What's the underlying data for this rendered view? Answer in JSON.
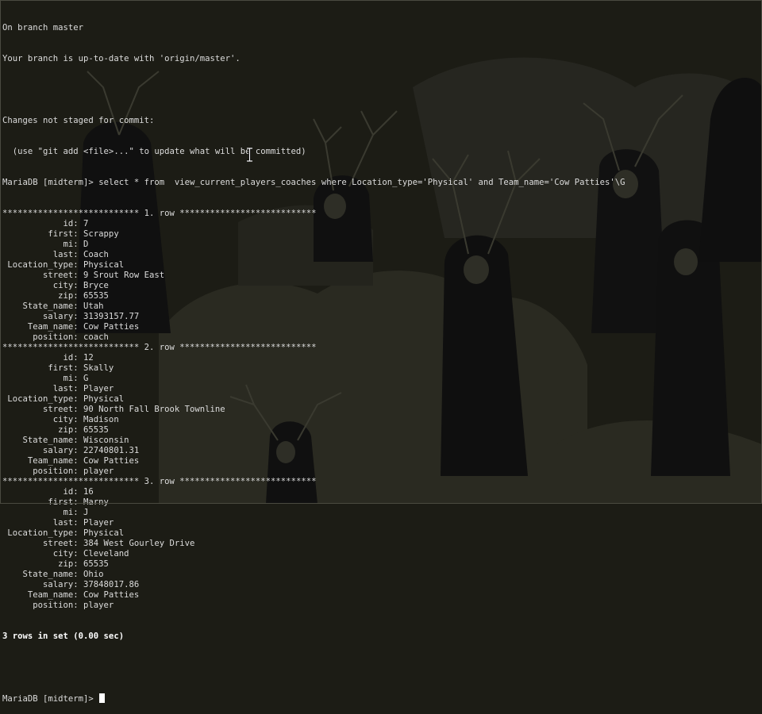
{
  "git": {
    "line1": "On branch master",
    "line2": "Your branch is up-to-date with 'origin/master'.",
    "line3": "Changes not staged for commit:",
    "line4": "  (use \"git add <file>...\" to update what will be committed)"
  },
  "query": {
    "prompt": "MariaDB [midterm]> ",
    "text": "select * from  view_current_players_coaches where Location_type='Physical' and Team_name='Cow Patties'\\G"
  },
  "row_sep": {
    "stars_left": "***************************",
    "stars_right": "***************************"
  },
  "rows": [
    {
      "header": " 1. row ",
      "fields": [
        {
          "key": "id",
          "value": "7"
        },
        {
          "key": "first",
          "value": "Scrappy"
        },
        {
          "key": "mi",
          "value": "D"
        },
        {
          "key": "last",
          "value": "Coach"
        },
        {
          "key": "Location_type",
          "value": "Physical"
        },
        {
          "key": "street",
          "value": "9 Srout Row East"
        },
        {
          "key": "city",
          "value": "Bryce"
        },
        {
          "key": "zip",
          "value": "65535"
        },
        {
          "key": "State_name",
          "value": "Utah"
        },
        {
          "key": "salary",
          "value": "31393157.77"
        },
        {
          "key": "Team_name",
          "value": "Cow Patties"
        },
        {
          "key": "position",
          "value": "coach"
        }
      ]
    },
    {
      "header": " 2. row ",
      "fields": [
        {
          "key": "id",
          "value": "12"
        },
        {
          "key": "first",
          "value": "Skally"
        },
        {
          "key": "mi",
          "value": "G"
        },
        {
          "key": "last",
          "value": "Player"
        },
        {
          "key": "Location_type",
          "value": "Physical"
        },
        {
          "key": "street",
          "value": "90 North Fall Brook Townline"
        },
        {
          "key": "city",
          "value": "Madison"
        },
        {
          "key": "zip",
          "value": "65535"
        },
        {
          "key": "State_name",
          "value": "Wisconsin"
        },
        {
          "key": "salary",
          "value": "22740801.31"
        },
        {
          "key": "Team_name",
          "value": "Cow Patties"
        },
        {
          "key": "position",
          "value": "player"
        }
      ]
    },
    {
      "header": " 3. row ",
      "fields": [
        {
          "key": "id",
          "value": "16"
        },
        {
          "key": "first",
          "value": "Marny"
        },
        {
          "key": "mi",
          "value": "J"
        },
        {
          "key": "last",
          "value": "Player"
        },
        {
          "key": "Location_type",
          "value": "Physical"
        },
        {
          "key": "street",
          "value": "384 West Gourley Drive"
        },
        {
          "key": "city",
          "value": "Cleveland"
        },
        {
          "key": "zip",
          "value": "65535"
        },
        {
          "key": "State_name",
          "value": "Ohio"
        },
        {
          "key": "salary",
          "value": "37848017.86"
        },
        {
          "key": "Team_name",
          "value": "Cow Patties"
        },
        {
          "key": "position",
          "value": "player"
        }
      ]
    }
  ],
  "result_summary": "3 rows in set (0.00 sec)",
  "final_prompt": "MariaDB [midterm]> ",
  "colors": {
    "background": "#1c1c15",
    "text": "#dcdcdc",
    "bold_text": "#ffffff",
    "wallpaper_shapes": "#2b2b22",
    "wallpaper_lines": "#3a3a30"
  },
  "icons": {
    "mouse_pointer": "text-ibeam-cursor",
    "terminal_cursor": "block-cursor"
  }
}
